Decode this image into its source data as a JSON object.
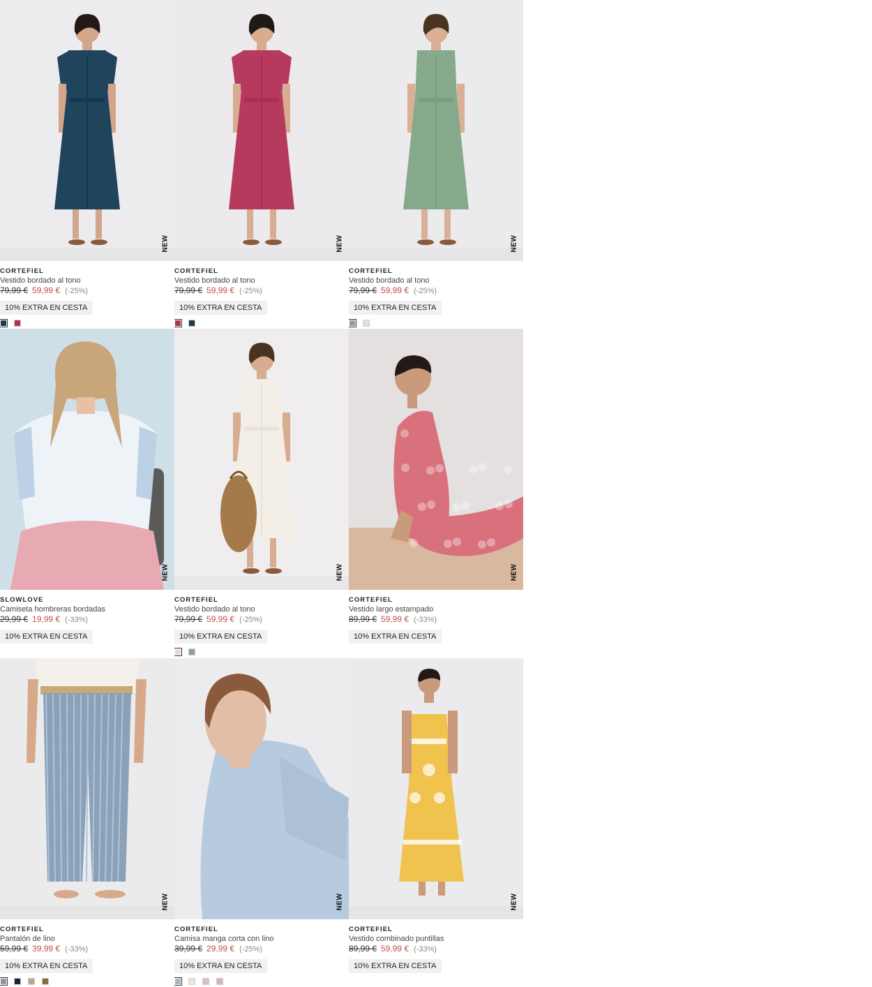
{
  "new_label": "NEW",
  "promo_label": "10% EXTRA EN CESTA",
  "products": [
    {
      "brand": "CORTEFIEL",
      "name": "Vestido bordado al tono",
      "old_price": "79,99 €",
      "price": "59,99 €",
      "discount": "(-25%)",
      "bg": "#ecebee",
      "garment": "#20445c",
      "skin": "#d3a58a",
      "hair": "#231a17",
      "type": "dress-short-sleeve",
      "swatches": [
        "#1f3a4f",
        "#b03255"
      ]
    },
    {
      "brand": "CORTEFIEL",
      "name": "Vestido bordado al tono",
      "old_price": "79,99 €",
      "price": "59,99 €",
      "discount": "(-25%)",
      "bg": "#eceaec",
      "garment": "#b63a5d",
      "skin": "#d8ac90",
      "hair": "#1e1816",
      "type": "dress-flutter",
      "swatches": [
        "#b03255",
        "#1f3a4f"
      ]
    },
    {
      "brand": "CORTEFIEL",
      "name": "Vestido bordado al tono",
      "old_price": "79,99 €",
      "price": "59,99 €",
      "discount": "(-25%)",
      "bg": "#ebeaed",
      "garment": "#86a98c",
      "skin": "#d9b095",
      "hair": "#4b3322",
      "type": "dress-sleeveless",
      "swatches": [
        "#8fa28f",
        "#e4dfdc"
      ]
    },
    {
      "brand": "SLOWLOVE",
      "name": "Camiseta hombreras bordadas",
      "old_price": "29,99 €",
      "price": "19,99 €",
      "discount": "(-33%)",
      "bg": "#cfdfe7",
      "garment": "#eef3f8",
      "skin": "#e8c1a5",
      "hair": "#c9a57a",
      "type": "tee-portrait",
      "swatches": []
    },
    {
      "brand": "CORTEFIEL",
      "name": "Vestido bordado al tono",
      "old_price": "79,99 €",
      "price": "59,99 €",
      "discount": "(-25%)",
      "bg": "#efeded",
      "garment": "#f3efe6",
      "skin": "#d8ac90",
      "hair": "#4a3323",
      "type": "dress-white-bag",
      "swatches": [
        "#e6dcd6",
        "#8fa28f"
      ]
    },
    {
      "brand": "CORTEFIEL",
      "name": "Vestido largo estampado",
      "old_price": "89,99 €",
      "price": "59,99 €",
      "discount": "(-33%)",
      "bg": "#e4e0df",
      "garment": "#d9717c",
      "skin": "#c99a7c",
      "hair": "#231a17",
      "type": "dress-seated",
      "swatches": []
    },
    {
      "brand": "CORTEFIEL",
      "name": "Pantalón de lino",
      "old_price": "59,99 €",
      "price": "39,99 €",
      "discount": "(-33%)",
      "bg": "#ecebec",
      "garment": "#8aa1b8",
      "skin": "#d6a98a",
      "hair": "#231a17",
      "type": "pants",
      "swatches": [
        "#8e9aa6",
        "#1c2533",
        "#b9a591",
        "#8b6a3e"
      ]
    },
    {
      "brand": "CORTEFIEL",
      "name": "Camisa manga corta con lino",
      "old_price": "39,99 €",
      "price": "29,99 €",
      "discount": "(-25%)",
      "bg": "#ecebee",
      "garment": "#b6cbe0",
      "skin": "#e1bea5",
      "hair": "#8a5a3c",
      "type": "shirt-portrait",
      "swatches": [
        "#a8b7c8",
        "#e8e6e6",
        "#d8c0c0",
        "#d8b0c8"
      ]
    },
    {
      "brand": "CORTEFIEL",
      "name": "Vestido combinado puntillas",
      "old_price": "89,99 €",
      "price": "59,99 €",
      "discount": "(-33%)",
      "bg": "#ebeaec",
      "garment": "#f0c24e",
      "skin": "#c99a7c",
      "hair": "#231a17",
      "type": "dress-yellow",
      "swatches": []
    }
  ]
}
